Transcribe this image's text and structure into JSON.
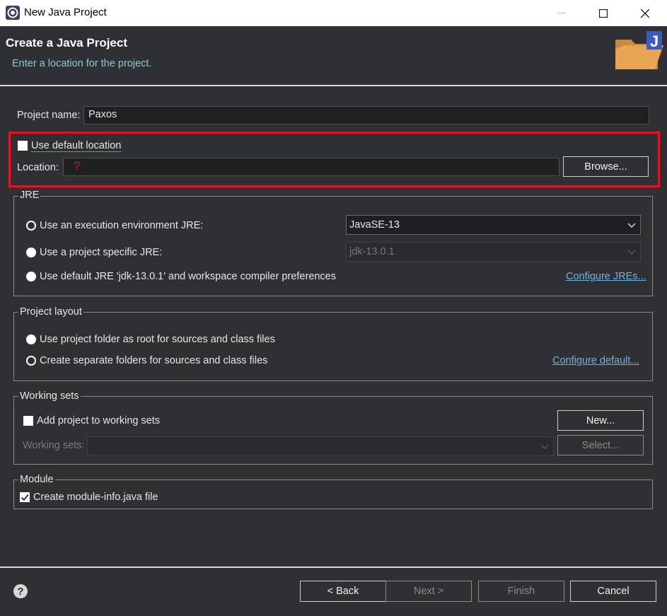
{
  "window": {
    "title": "New Java Project"
  },
  "header": {
    "title": "Create a Java Project",
    "subtitle": "Enter a location for the project."
  },
  "project_name": {
    "label": "Project name:",
    "value": "Paxos"
  },
  "location_section": {
    "use_default_label": "Use default location",
    "use_default_checked": false,
    "location_label": "Location:",
    "location_value": "",
    "error_marker": "?",
    "browse_label": "Browse...",
    "highlight_color": "#e81123"
  },
  "jre": {
    "group_label": "JRE",
    "option_exec_env": "Use an execution environment JRE:",
    "option_project_specific": "Use a project specific JRE:",
    "option_default": "Use default JRE 'jdk-13.0.1' and workspace compiler preferences",
    "exec_env_value": "JavaSE-13",
    "project_specific_value": "jdk-13.0.1",
    "configure_link": "Configure JREs..."
  },
  "project_layout": {
    "group_label": "Project layout",
    "option_root": "Use project folder as root for sources and class files",
    "option_separate": "Create separate folders for sources and class files",
    "configure_link": "Configure default..."
  },
  "working_sets": {
    "group_label": "Working sets",
    "add_label": "Add project to working sets",
    "new_button": "New...",
    "sets_label": "Working sets:",
    "select_button": "Select..."
  },
  "module": {
    "group_label": "Module",
    "create_label": "Create module-info.java file",
    "checked": true
  },
  "footer": {
    "help_icon": "help-icon",
    "back": "< Back",
    "next": "Next >",
    "finish": "Finish",
    "cancel": "Cancel"
  }
}
